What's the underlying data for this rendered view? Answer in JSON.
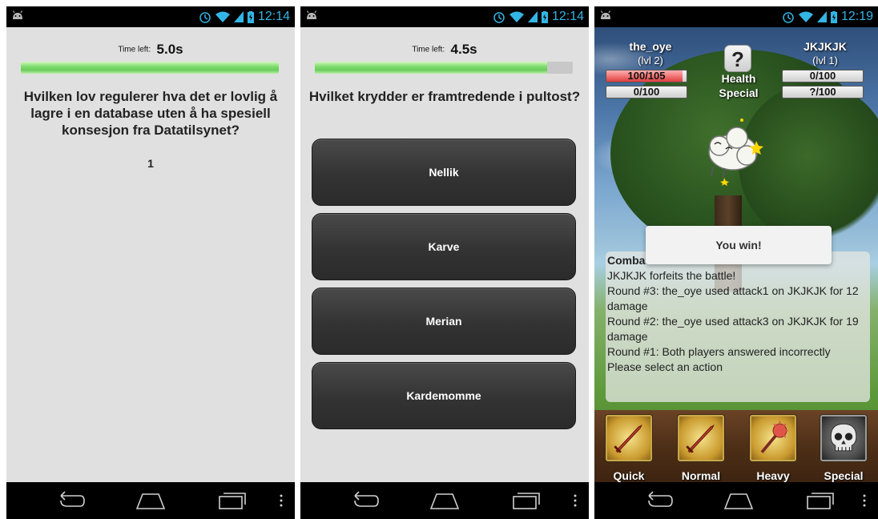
{
  "status_bar": {
    "time_1": "12:14",
    "time_2": "12:14",
    "time_3": "12:19"
  },
  "screen1": {
    "timer_label": "Time left:",
    "timer_value": "5.0s",
    "progress_fraction": 1.0,
    "question": "Hvilken lov regulerer hva det er lovlig å lagre i en database uten å ha spesiell konsesjon fra Datatilsynet?",
    "answer": "1"
  },
  "screen2": {
    "timer_label": "Time left:",
    "timer_value": "4.5s",
    "progress_fraction": 0.9,
    "question": "Hvilket krydder er framtredende i pultost?",
    "answers": [
      "Nellik",
      "Karve",
      "Merian",
      "Kardemomme"
    ]
  },
  "screen3": {
    "player1": {
      "name": "the_oye",
      "level": "(lvl 2)",
      "health": "100/105",
      "health_fraction": 0.952,
      "special": "0/100"
    },
    "player2": {
      "name": "JKJKJK",
      "level": "(lvl 1)",
      "health": "0/100",
      "special": "?/100"
    },
    "question_mark": "?",
    "health_label": "Health",
    "special_label": "Special",
    "dialog": "You win!",
    "log_title": "Comba",
    "log_lines": [
      "JKJKJK forfeits the battle!",
      "Round #3: the_oye used attack1 on JKJKJK for 12 damage",
      "Round #2: the_oye used attack3 on JKJKJK for 19 damage",
      "Round #1: Both players answered incorrectly",
      "Please select an action"
    ],
    "actions": [
      "Quick",
      "Normal",
      "Heavy",
      "Special"
    ]
  },
  "icons": [
    "android-notification-icon",
    "alarm-icon",
    "wifi-icon",
    "signal-icon",
    "battery-icon",
    "back-icon",
    "home-icon",
    "recents-icon",
    "menu-icon"
  ],
  "colors": {
    "status_blue": "#33b5e5",
    "progress_green": "#6ccc5c",
    "button_dark": "#333333",
    "health_red": "#e13d3d"
  }
}
